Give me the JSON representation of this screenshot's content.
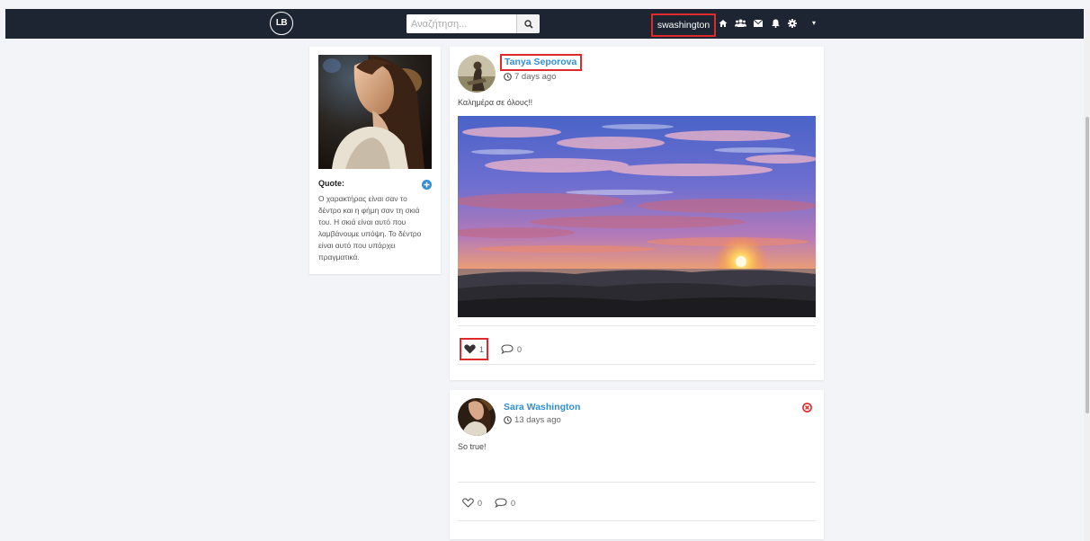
{
  "navbar": {
    "logo": "LB",
    "search_placeholder": "Αναζήτηση...",
    "username": "swashington",
    "icons": [
      "home-icon",
      "users-icon",
      "envelope-icon",
      "bell-icon",
      "gear-icon"
    ]
  },
  "profile": {
    "quote_title": "Quote:",
    "quote_text": "Ο χαρακτήρας είναι σαν το δέντρο και η φήμη σαν τη σκιά του. Η σκιά είναι αυτό που λαμβάνουμε υπόψη. Το δέντρο είναι αυτό που υπάρχει πραγματικά."
  },
  "posts": [
    {
      "author": "Tanya Seporova",
      "time": "7 days ago",
      "text": "Καλημέρα σε όλους!!",
      "likes": "1",
      "comments": "0",
      "liked": true
    },
    {
      "author": "Sara Washington",
      "time": "13 days ago",
      "text": "So true!",
      "likes": "0",
      "comments": "0",
      "liked": false
    }
  ],
  "colors": {
    "navbar": "#1d2532",
    "link": "#2f8fd8",
    "highlight": "#e02a2a",
    "background": "#f3f4f8"
  }
}
